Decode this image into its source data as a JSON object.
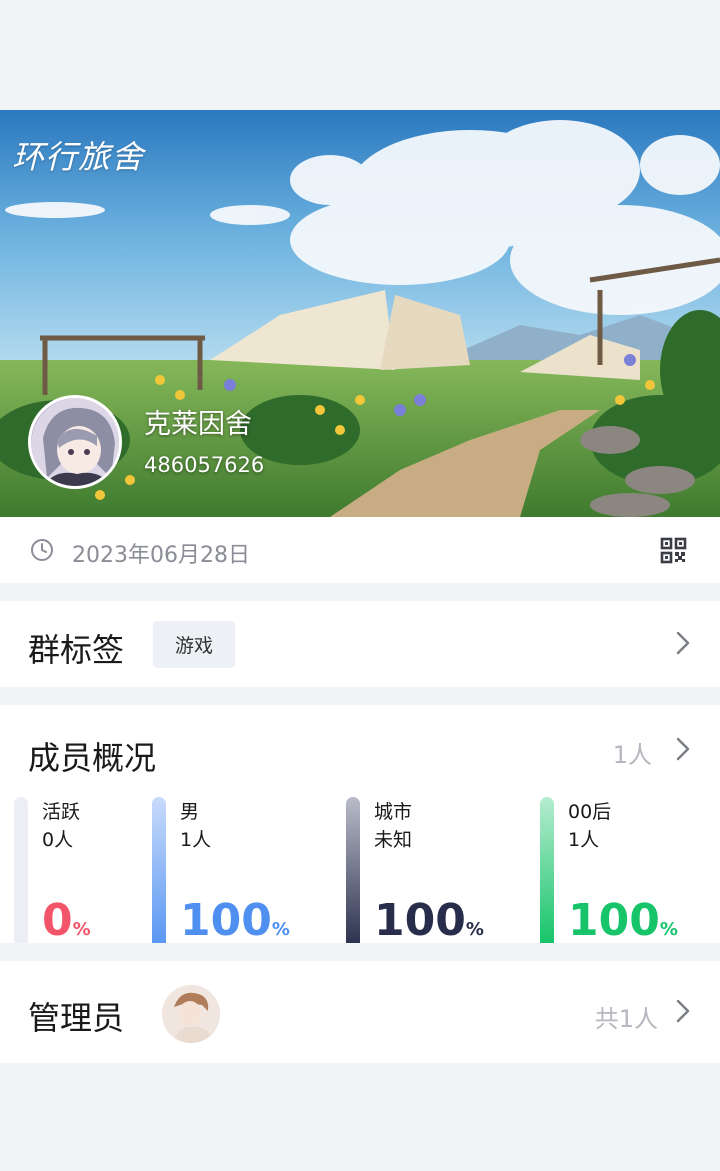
{
  "banner": {
    "logo_text": "环行旅舍",
    "group_name": "克莱因舍",
    "group_id": "486057626"
  },
  "info": {
    "date": "2023年06月28日",
    "clock_icon": "clock-icon",
    "qr_icon": "qr-code-icon"
  },
  "tags": {
    "title": "群标签",
    "items": [
      "游戏"
    ]
  },
  "members": {
    "title": "成员概况",
    "count": "1人",
    "stats": [
      {
        "label": "活跃",
        "value": "0人",
        "percent": "0",
        "unit": "%",
        "color": "#f2546a",
        "bar_color": "#eceef3"
      },
      {
        "label": "男",
        "value": "1人",
        "percent": "100",
        "unit": "%",
        "color": "#4f8ff0",
        "bar_color": "#6aa1f3"
      },
      {
        "label": "城市",
        "value": "未知",
        "percent": "100",
        "unit": "%",
        "color": "#272d4a",
        "bar_color": "#3a3f5c"
      },
      {
        "label": "00后",
        "value": "1人",
        "percent": "100",
        "unit": "%",
        "color": "#17c46a",
        "bar_color": "#1fcf74"
      }
    ]
  },
  "admins": {
    "title": "管理员",
    "count": "共1人"
  }
}
